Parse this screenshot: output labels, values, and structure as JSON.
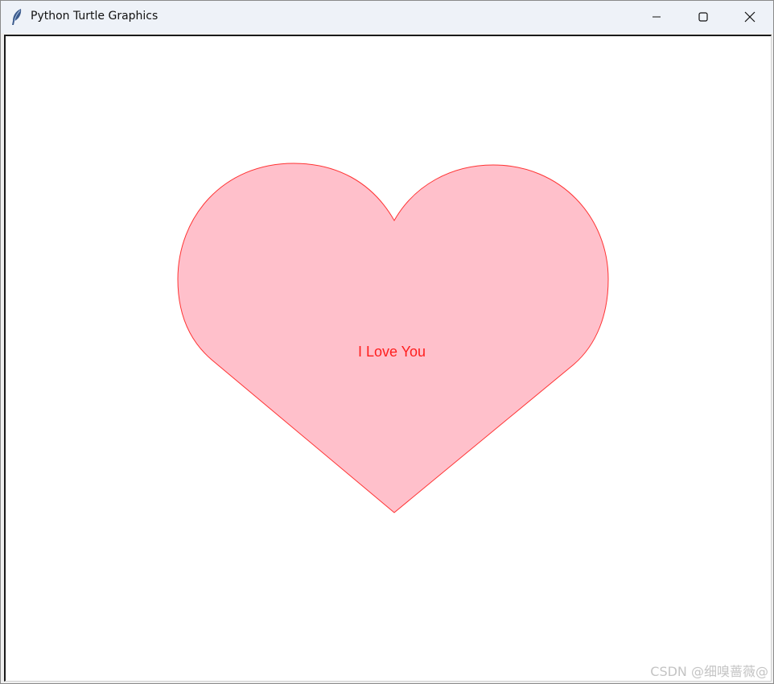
{
  "window": {
    "title": "Python Turtle Graphics",
    "app_icon": "feather-icon",
    "controls": {
      "minimize_icon": "minimize-icon",
      "maximize_icon": "maximize-icon",
      "close_icon": "close-icon"
    }
  },
  "canvas": {
    "background": "#ffffff",
    "heart": {
      "fill_color": "#ffc0cb",
      "outline_color": "#ff3333"
    },
    "text": "I Love You",
    "text_color": "#ff1e1e"
  },
  "watermark": "CSDN @细嗅蔷薇@"
}
